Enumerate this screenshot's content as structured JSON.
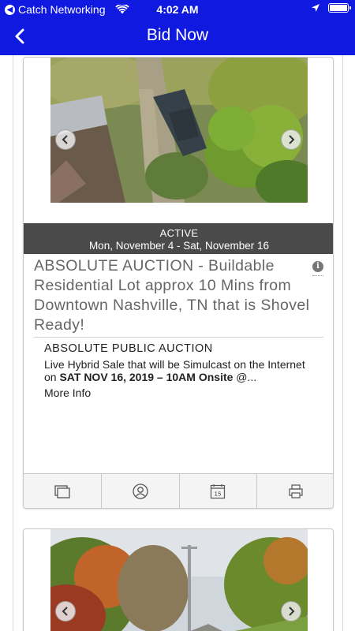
{
  "status_bar": {
    "carrier": "Catch Networking",
    "time": "4:02 AM"
  },
  "nav": {
    "title": "Bid Now"
  },
  "listings": [
    {
      "status": "ACTIVE",
      "dates": "Mon, November 4 - Sat, November 16",
      "headline": "ABSOLUTE AUCTION - Buildable Residential Lot approx 10 Mins from Downtown Nashville, TN that is Shovel Ready!",
      "subtitle": "ABSOLUTE PUBLIC AUCTION",
      "description_pre": "Live Hybrid Sale that will be Simulcast on the Internet on ",
      "description_bold": "SAT NOV 16, 2019 – 10AM Onsite",
      "description_post": " @...",
      "more_info": "More Info",
      "calendar_day": "15"
    }
  ],
  "colors": {
    "nav_bg": "#1019e0",
    "status_strip": "#4a4a4a",
    "headline_text": "#666666"
  }
}
